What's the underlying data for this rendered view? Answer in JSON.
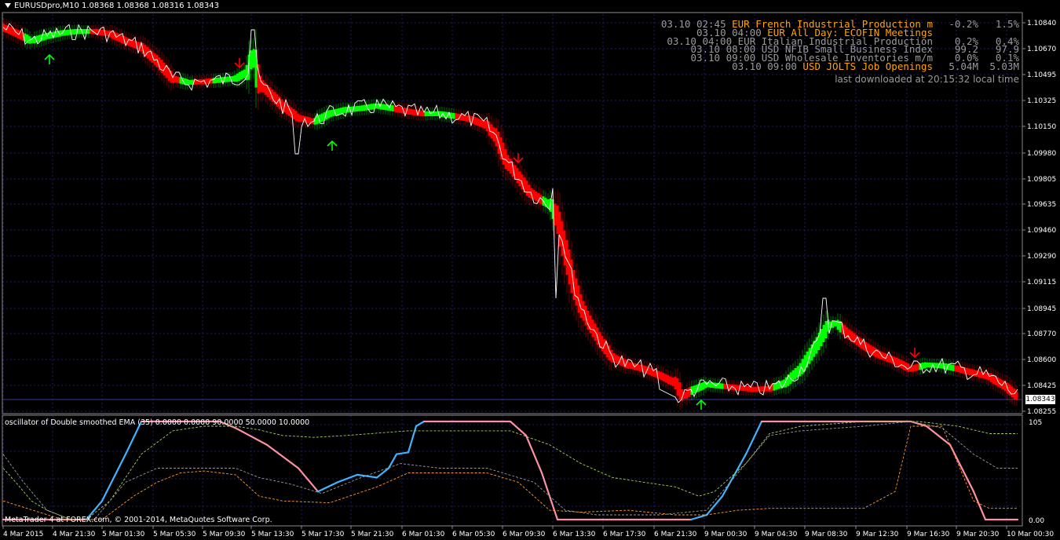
{
  "header": {
    "symbol_label": "EURUSDpro,M10  1.08368 1.08368 1.08316 1.08343"
  },
  "news": [
    {
      "time": "03.10 02:45",
      "currency": "EUR",
      "event": "French Industrial Production m",
      "actual": "-0.2%",
      "forecast": "1.5%",
      "color": "orange"
    },
    {
      "time": "03.10 04:00",
      "currency": "EUR",
      "event": "All Day: ECOFIN Meetings",
      "actual": "",
      "forecast": "",
      "color": "orange"
    },
    {
      "time": "03.10 04:00",
      "currency": "EUR",
      "event": "Italian Industrial Production",
      "actual": "0.2%",
      "forecast": "0.4%",
      "color": "gray"
    },
    {
      "time": "03.10 08:00",
      "currency": "USD",
      "event": "NFIB Small Business Index",
      "actual": "99.2",
      "forecast": "97.9",
      "color": "gray"
    },
    {
      "time": "03.10 09:00",
      "currency": "USD",
      "event": "Wholesale Inventories m/m",
      "actual": "0.0%",
      "forecast": "0.1%",
      "color": "gray"
    },
    {
      "time": "03.10 09:00",
      "currency": "USD",
      "event": "JOLTS Job Openings",
      "actual": "5.04M",
      "forecast": "5.03M",
      "color": "orange"
    }
  ],
  "news_footer": "last downloaded at 20:15:32 local time",
  "price_axis": [
    "1.10840",
    "1.10670",
    "1.10495",
    "1.10325",
    "1.10150",
    "1.09980",
    "1.09805",
    "1.09635",
    "1.09460",
    "1.09290",
    "1.09115",
    "1.08945",
    "1.08770",
    "1.08600",
    "1.08425",
    "1.08255"
  ],
  "current_price": "1.08343",
  "oscillator": {
    "title": "oscillator of Double smoothed EMA (35) 0.0000 0.0000 90.0000 50.0000 10.0000",
    "max_label": "105",
    "min_label": "0.00"
  },
  "time_axis": [
    "4 Mar 2015",
    "4 Mar 21:30",
    "5 Mar 01:30",
    "5 Mar 05:30",
    "5 Mar 09:30",
    "5 Mar 13:30",
    "5 Mar 17:30",
    "5 Mar 21:30",
    "6 Mar 01:30",
    "6 Mar 05:30",
    "6 Mar 09:30",
    "6 Mar 13:30",
    "6 Mar 17:30",
    "6 Mar 21:30",
    "9 Mar 00:30",
    "9 Mar 04:30",
    "9 Mar 08:30",
    "9 Mar 12:30",
    "9 Mar 16:30",
    "9 Mar 20:30",
    "10 Mar 00:30"
  ],
  "copyright": "MetaTrader 4 at FOREX.com, © 2001-2014, MetaQuotes Software Corp.",
  "colors": {
    "background": "#000000",
    "grid": "#1c1c6e",
    "up": "#00ff00",
    "down": "#ff0000",
    "osc_up": "#3fb5ff",
    "osc_down": "#ff8fa3",
    "level": "#ff9a2e",
    "signal": "#9fd25f"
  },
  "chart_data": {
    "type": "line",
    "instrument": "EURUSDpro",
    "timeframe": "M10",
    "ylim": [
      1.0824,
      1.1092
    ],
    "x": [
      "4 Mar 2015",
      "4 Mar 21:30",
      "5 Mar 01:30",
      "5 Mar 05:30",
      "5 Mar 09:30",
      "5 Mar 13:30",
      "5 Mar 17:30",
      "5 Mar 21:30",
      "6 Mar 01:30",
      "6 Mar 05:30",
      "6 Mar 09:30",
      "6 Mar 13:30",
      "6 Mar 17:30",
      "6 Mar 21:30",
      "9 Mar 00:30",
      "9 Mar 04:30",
      "9 Mar 08:30",
      "9 Mar 12:30",
      "9 Mar 16:30",
      "9 Mar 20:30",
      "10 Mar 00:30"
    ],
    "series": [
      {
        "values": [
          1.1073,
          1.1081,
          1.1076,
          1.105,
          1.105,
          1.1063,
          1.101,
          1.1022,
          1.1023,
          1.1015,
          1.0988,
          1.0868,
          1.0857,
          1.0832,
          1.084,
          1.0842,
          1.089,
          1.0858,
          1.0855,
          1.0848,
          1.0834
        ]
      },
      {
        "values": [
          1.1077,
          1.108,
          1.1078,
          1.1054,
          1.1048,
          1.105,
          1.1015,
          1.1025,
          1.1024,
          1.1018,
          1.0975,
          1.088,
          1.0856,
          1.0838,
          1.0843,
          1.0843,
          1.0885,
          1.0863,
          1.0856,
          1.085,
          1.0838
        ]
      }
    ]
  }
}
